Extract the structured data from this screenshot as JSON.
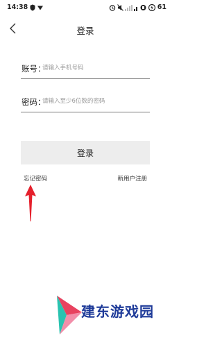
{
  "status_bar": {
    "time": "14:38",
    "battery": "61",
    "icons": [
      "security-shield-icon",
      "wifi-icon",
      "alarm-icon",
      "mute-icon",
      "signal-icon",
      "battery-icon"
    ]
  },
  "nav": {
    "title": "登录"
  },
  "form": {
    "account_label": "账号：",
    "account_placeholder": "请输入手机号码",
    "password_label": "密码：",
    "password_placeholder": "请输入至少6位数的密码"
  },
  "actions": {
    "login_label": "登录",
    "forgot_label": "忘记密码",
    "register_label": "新用户注册"
  },
  "watermark": {
    "text": "建东游戏园"
  },
  "colors": {
    "arrow": "#e5202c",
    "watermark_text": "#1f3b99",
    "watermark_logo_1": "#e8425f",
    "watermark_logo_2": "#29c3b0",
    "button_bg": "#ededed"
  }
}
